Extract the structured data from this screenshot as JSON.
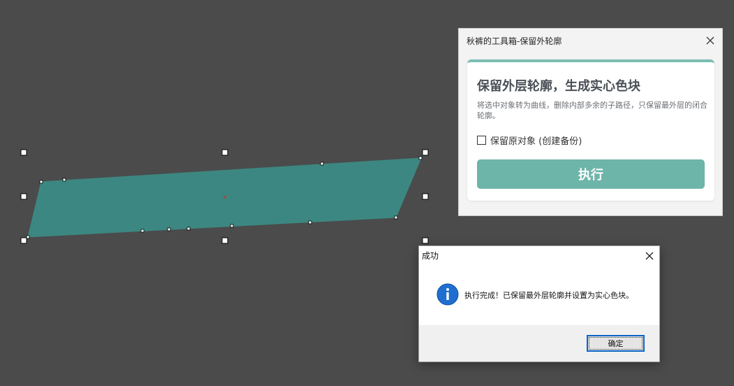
{
  "colors": {
    "canvas_background": "#4b4b4b",
    "shape_fill": "#3c8781",
    "accent": "#6db5a9",
    "card_top_border": "#7cbdb2",
    "info_icon": "#1e6fd0"
  },
  "tool_panel": {
    "title": "秋裤的工具箱-保留外轮廓",
    "close_icon": "close-icon",
    "heading": "保留外层轮廓，生成实心色块",
    "description": "将选中对象转为曲线，删除内部多余的子路径，只保留最外层的闭合轮廓。",
    "checkbox_label": "保留原对象 (创建备份)",
    "checkbox_checked": false,
    "execute_button": "执行"
  },
  "message_box": {
    "title": "成功",
    "icon": "info-icon",
    "message": "执行完成！已保留最外层轮廓并设置为实心色块。",
    "ok_button": "确定"
  }
}
